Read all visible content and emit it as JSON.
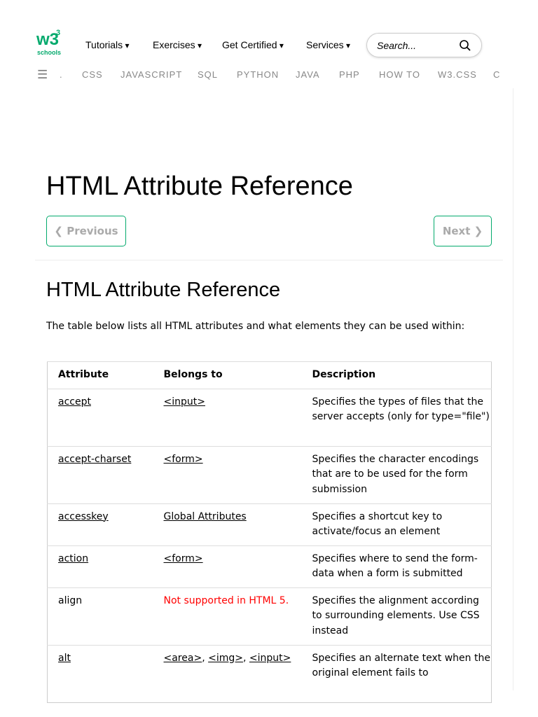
{
  "logo": {
    "text": "w3",
    "sup": "3",
    "sub": "schools"
  },
  "nav": [
    "Tutorials",
    "Exercises",
    "Get Certified",
    "Services"
  ],
  "search": {
    "placeholder": "Search..."
  },
  "subnav": [
    ".",
    "CSS",
    "JAVASCRIPT",
    "SQL",
    "PYTHON",
    "JAVA",
    "PHP",
    "HOW TO",
    "W3.CSS",
    "C"
  ],
  "title": "HTML Attribute Reference",
  "prev": "❮ Previous",
  "next": "Next ❯",
  "heading": "HTML Attribute Reference",
  "intro": "The table below lists all HTML attributes and what elements they can be used within:",
  "table": {
    "headers": [
      "Attribute",
      "Belongs to",
      "Description"
    ],
    "rows": [
      {
        "attr": "accept",
        "belongs": "<input>",
        "desc": "Specifies the types of files that the server accepts (only for type=\"file\")"
      },
      {
        "attr": "accept-charset",
        "belongs": "<form>",
        "desc": "Specifies the character encodings that are to be used for the form submission"
      },
      {
        "attr": "accesskey",
        "belongs": "Global Attributes",
        "desc": "Specifies a shortcut key to activate/focus an element"
      },
      {
        "attr": "action",
        "belongs": "<form>",
        "desc": "Specifies where to send the form-data when a form is submitted"
      },
      {
        "attr": "align",
        "belongs": "Not supported in HTML 5.",
        "desc": "Specifies the alignment according to surrounding elements. Use CSS instead"
      },
      {
        "attr": "alt",
        "belongs_list": [
          "<area>",
          "<img>",
          "<input>"
        ],
        "sep": ", ",
        "desc": "Specifies an alternate text when the original element fails to"
      }
    ]
  }
}
